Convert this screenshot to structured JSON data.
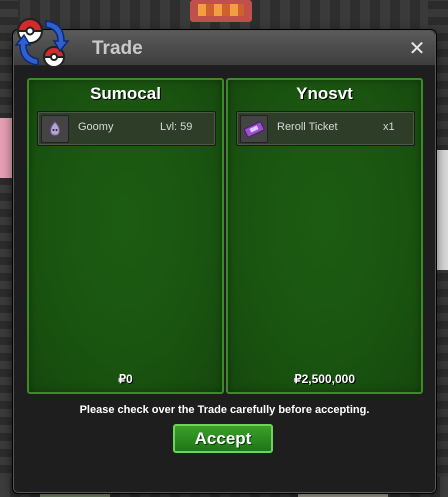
{
  "window": {
    "title": "Trade",
    "close_label": "✕",
    "title_icon": "trade-swap-icon"
  },
  "panels": [
    {
      "player": "Sumocal",
      "items": [
        {
          "icon": "goomy-icon",
          "name": "Goomy",
          "extra": "Lvl: 59"
        }
      ],
      "money": "₽0"
    },
    {
      "player": "Ynosvt",
      "items": [
        {
          "icon": "reroll-ticket-icon",
          "name": "Reroll Ticket",
          "extra": "x1"
        }
      ],
      "money": "₽2,500,000"
    }
  ],
  "footer": {
    "note": "Please check over the Trade carefully before accepting.",
    "accept_label": "Accept"
  },
  "colors": {
    "panel_green": "#1a5510",
    "panel_border": "#3e8a2a",
    "accept_green": "#2a8a1f"
  }
}
